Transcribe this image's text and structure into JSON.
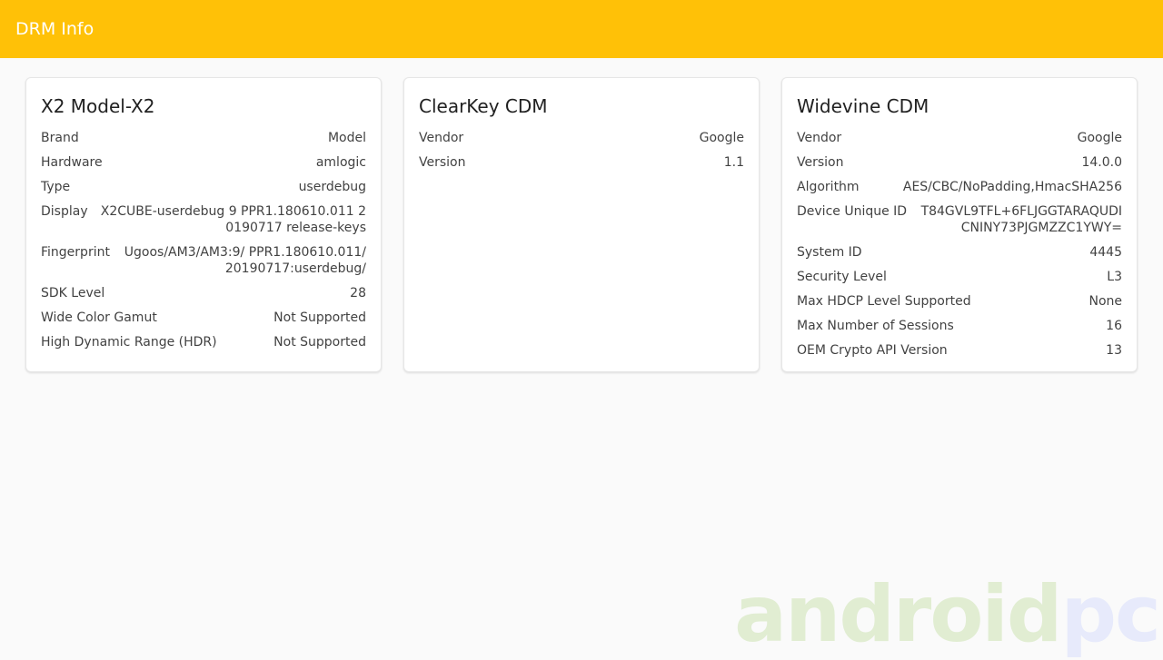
{
  "appbar": {
    "title": "DRM Info"
  },
  "cards": [
    {
      "title": "X2 Model-X2",
      "rows": [
        {
          "label": "Brand",
          "value": "Model"
        },
        {
          "label": "Hardware",
          "value": "amlogic"
        },
        {
          "label": "Type",
          "value": "userdebug"
        },
        {
          "label": "Display",
          "value": "X2CUBE-userdebug 9 PPR1.180610.011 20190717 release-keys"
        },
        {
          "label": "Fingerprint",
          "value": "Ugoos/AM3/AM3:9/ PPR1.180610.011/20190717:userdebug/"
        },
        {
          "label": "SDK Level",
          "value": "28"
        },
        {
          "label": "Wide Color Gamut",
          "value": "Not Supported"
        },
        {
          "label": "High Dynamic Range (HDR)",
          "value": "Not Supported"
        }
      ]
    },
    {
      "title": "ClearKey CDM",
      "rows": [
        {
          "label": "Vendor",
          "value": "Google"
        },
        {
          "label": "Version",
          "value": "1.1"
        }
      ]
    },
    {
      "title": "Widevine CDM",
      "rows": [
        {
          "label": "Vendor",
          "value": "Google"
        },
        {
          "label": "Version",
          "value": "14.0.0"
        },
        {
          "label": "Algorithm",
          "value": "AES/CBC/NoPadding,HmacSHA256"
        },
        {
          "label": "Device Unique ID",
          "value": "T84GVL9TFL+6FLJGGTARAQUDICNINY73PJGMZZC1YWY="
        },
        {
          "label": "System ID",
          "value": "4445"
        },
        {
          "label": "Security Level",
          "value": "L3"
        },
        {
          "label": "Max HDCP Level Supported",
          "value": "None"
        },
        {
          "label": "Max Number of Sessions",
          "value": "16"
        },
        {
          "label": "OEM Crypto API Version",
          "value": "13"
        }
      ]
    }
  ],
  "watermark": {
    "part1": "android",
    "part2": "pc"
  },
  "colors": {
    "appbar": "#ffc107",
    "background": "#fafafa",
    "card": "#ffffff"
  }
}
